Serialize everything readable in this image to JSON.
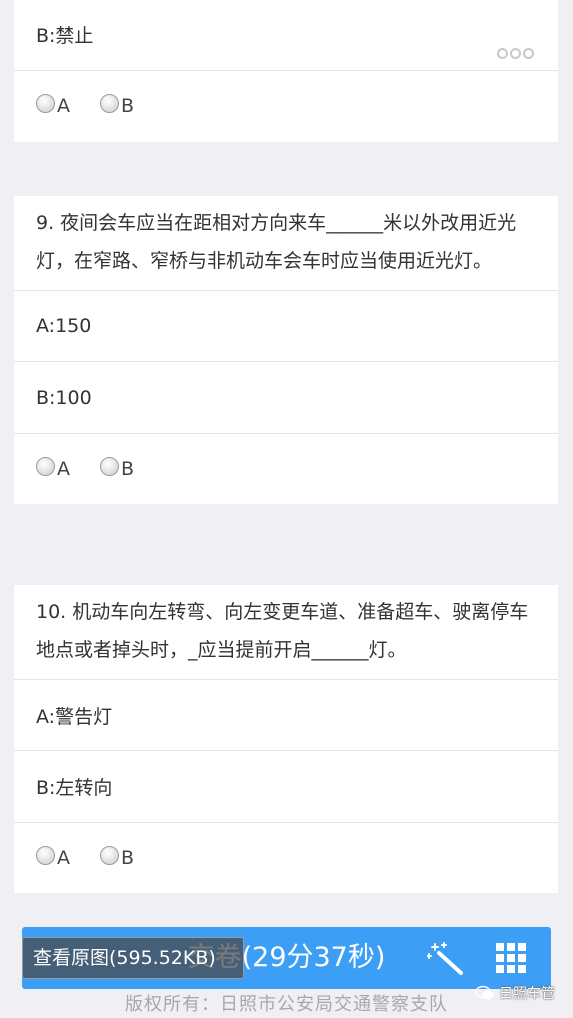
{
  "questions": [
    {
      "options": [
        "B:禁止"
      ],
      "choices": [
        "A",
        "B"
      ]
    },
    {
      "question": "9. 夜间会车应当在距相对方向来车______米以外改用近光灯，在窄路、窄桥与非机动车会车时应当使用近光灯。",
      "options": [
        "A:150",
        "B:100"
      ],
      "choices": [
        "A",
        "B"
      ]
    },
    {
      "question": "10. 机动车向左转弯、向左变更车道、准备超车、驶离停车地点或者掉头时，_应当提前开启______灯。",
      "options": [
        "A:警告灯",
        "B:左转向"
      ],
      "choices": [
        "A",
        "B"
      ]
    }
  ],
  "toolbar": {
    "view_original": "查看原图(595.52KB)",
    "submit": "交卷(29分37秒)"
  },
  "footer": {
    "copyright": "版权所有：日照市公安局交通警察支队",
    "watermark": "日照车管"
  },
  "colors": {
    "accent": "#3d9ef5",
    "background": "#efeff4"
  },
  "icons": [
    "more-dots-icon",
    "radio-icon",
    "magic-wand-icon",
    "grid-icon",
    "wechat-icon"
  ]
}
